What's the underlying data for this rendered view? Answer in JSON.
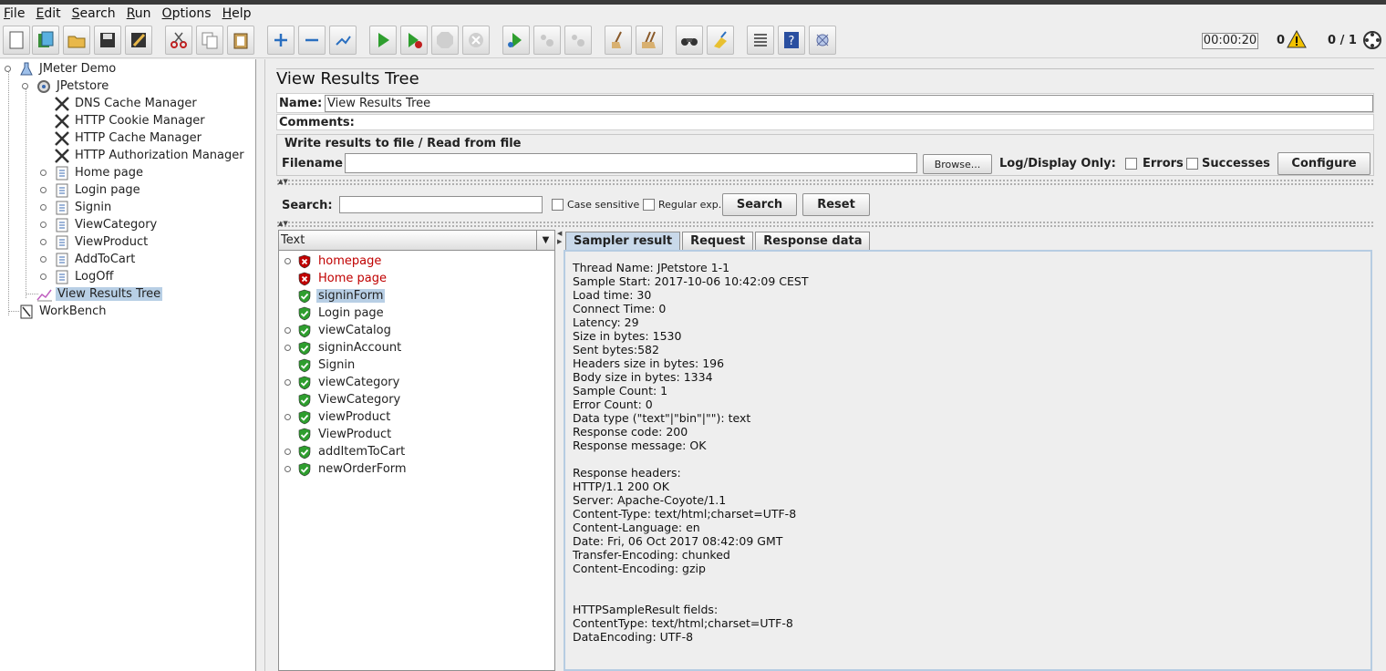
{
  "menu": [
    "File",
    "Edit",
    "Search",
    "Run",
    "Options",
    "Help"
  ],
  "toolbar": {
    "buttons": [
      "new-icon",
      "templates-icon",
      "open-icon",
      "save-icon",
      "save-as-icon",
      "cut-icon",
      "copy-icon",
      "paste-icon",
      "expand-icon",
      "collapse-icon",
      "toggle-icon",
      "start-icon",
      "start-no-pause-icon",
      "stop-icon",
      "shutdown-icon",
      "remote-start-icon",
      "remote-stop-icon",
      "remote-shutdown-icon",
      "clear-icon",
      "clear-all-icon",
      "search-icon",
      "reset-search-icon",
      "function-helper-icon",
      "help-icon",
      "logger-icon"
    ],
    "timer": "00:00:20",
    "warning_count": "0",
    "threads": "0 / 1"
  },
  "test_plan_tree": [
    {
      "label": "JMeter Demo",
      "icon": "test-plan-icon"
    },
    {
      "label": "JPetstore",
      "icon": "thread-group-icon"
    },
    {
      "label": "DNS Cache Manager",
      "icon": "config-element-icon"
    },
    {
      "label": "HTTP Cookie Manager",
      "icon": "config-element-icon"
    },
    {
      "label": "HTTP Cache Manager",
      "icon": "config-element-icon"
    },
    {
      "label": "HTTP Authorization Manager",
      "icon": "config-element-icon"
    },
    {
      "label": "Home page",
      "icon": "transaction-controller-icon"
    },
    {
      "label": "Login page",
      "icon": "transaction-controller-icon"
    },
    {
      "label": "Signin",
      "icon": "transaction-controller-icon"
    },
    {
      "label": "ViewCategory",
      "icon": "transaction-controller-icon"
    },
    {
      "label": "ViewProduct",
      "icon": "transaction-controller-icon"
    },
    {
      "label": "AddToCart",
      "icon": "transaction-controller-icon"
    },
    {
      "label": "LogOff",
      "icon": "transaction-controller-icon"
    },
    {
      "label": "View Results Tree",
      "icon": "listener-icon"
    },
    {
      "label": "WorkBench",
      "icon": "workbench-icon"
    }
  ],
  "panel": {
    "title": "View Results Tree",
    "name_label": "Name:",
    "name_value": "View Results Tree",
    "comments_label": "Comments:",
    "file_group_title": "Write results to file / Read from file",
    "filename_label": "Filename",
    "browse_label": "Browse...",
    "log_display_label": "Log/Display Only:",
    "errors_label": "Errors",
    "successes_label": "Successes",
    "configure_label": "Configure",
    "search_label": "Search:",
    "case_sensitive_label": "Case sensitive",
    "regular_exp_label": "Regular exp.",
    "search_button": "Search",
    "reset_button": "Reset",
    "renderer_selected": "Text"
  },
  "results": [
    {
      "label": "homepage",
      "status": "failed",
      "expandable": true
    },
    {
      "label": "Home page",
      "status": "failed",
      "expandable": false
    },
    {
      "label": "signinForm",
      "status": "success",
      "expandable": false
    },
    {
      "label": "Login page",
      "status": "success",
      "expandable": false
    },
    {
      "label": "viewCatalog",
      "status": "success",
      "expandable": true
    },
    {
      "label": "signinAccount",
      "status": "success",
      "expandable": true
    },
    {
      "label": "Signin",
      "status": "success",
      "expandable": false
    },
    {
      "label": "viewCategory",
      "status": "success",
      "expandable": true
    },
    {
      "label": "ViewCategory",
      "status": "success",
      "expandable": false
    },
    {
      "label": "viewProduct",
      "status": "success",
      "expandable": true
    },
    {
      "label": "ViewProduct",
      "status": "success",
      "expandable": false
    },
    {
      "label": "addItemToCart",
      "status": "success",
      "expandable": true
    },
    {
      "label": "newOrderForm",
      "status": "success",
      "expandable": true
    }
  ],
  "tabs": [
    "Sampler result",
    "Request",
    "Response data"
  ],
  "sampler_result_text": "Thread Name: JPetstore 1-1\nSample Start: 2017-10-06 10:42:09 CEST\nLoad time: 30\nConnect Time: 0\nLatency: 29\nSize in bytes: 1530\nSent bytes:582\nHeaders size in bytes: 196\nBody size in bytes: 1334\nSample Count: 1\nError Count: 0\nData type (\"text\"|\"bin\"|\"\"): text\nResponse code: 200\nResponse message: OK\n\nResponse headers:\nHTTP/1.1 200 OK\nServer: Apache-Coyote/1.1\nContent-Type: text/html;charset=UTF-8\nContent-Language: en\nDate: Fri, 06 Oct 2017 08:42:09 GMT\nTransfer-Encoding: chunked\nContent-Encoding: gzip\n\n\nHTTPSampleResult fields:\nContentType: text/html;charset=UTF-8\nDataEncoding: UTF-8",
  "colors": {
    "failed": "#c00000",
    "success": "#2e9e2e",
    "selection": "#b8cfe5"
  }
}
